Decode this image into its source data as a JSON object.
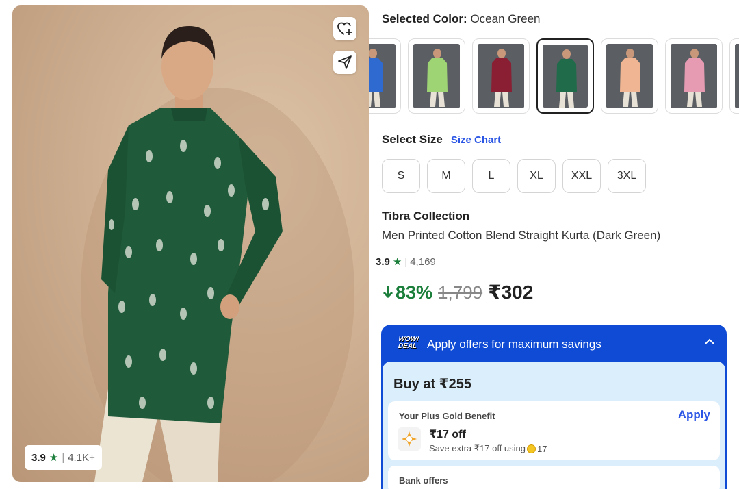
{
  "product_image": {
    "rating": "3.9",
    "rating_count": "4.1K+"
  },
  "colors": {
    "label": "Selected Color:",
    "selected": "Ocean Green",
    "swatches": [
      {
        "color": "#2f6ad0",
        "selected": false
      },
      {
        "color": "#9fd474",
        "selected": false
      },
      {
        "color": "#8a1f34",
        "selected": false
      },
      {
        "color": "#1f6b4a",
        "selected": true
      },
      {
        "color": "#f0b592",
        "selected": false
      },
      {
        "color": "#e69bb2",
        "selected": false
      },
      {
        "color": "#c9c9c9",
        "selected": false
      }
    ]
  },
  "sizes": {
    "label": "Select Size",
    "chart_link": "Size Chart",
    "options": [
      "S",
      "M",
      "L",
      "XL",
      "XXL",
      "3XL"
    ]
  },
  "product": {
    "brand": "Tibra Collection",
    "name": "Men Printed Cotton Blend Straight Kurta (Dark Green)",
    "rating": "3.9",
    "rating_count": "4,169",
    "discount": "83%",
    "mrp": "1,799",
    "price": "₹302"
  },
  "offers": {
    "badge": "WOW! DEAL",
    "title": "Apply offers for maximum savings",
    "buy_at": "Buy at ₹255",
    "gold": {
      "title": "Your Plus Gold Benefit",
      "apply": "Apply",
      "amount": "₹17 off",
      "save_text": "Save extra ₹17 off using",
      "coins": "17"
    },
    "bank": {
      "title": "Bank offers"
    }
  },
  "theme": {
    "accent_blue": "#2a55e5",
    "offer_blue": "#0f4bd4",
    "green": "#1b7f3b",
    "kurta_green": "#1f5a3a"
  }
}
